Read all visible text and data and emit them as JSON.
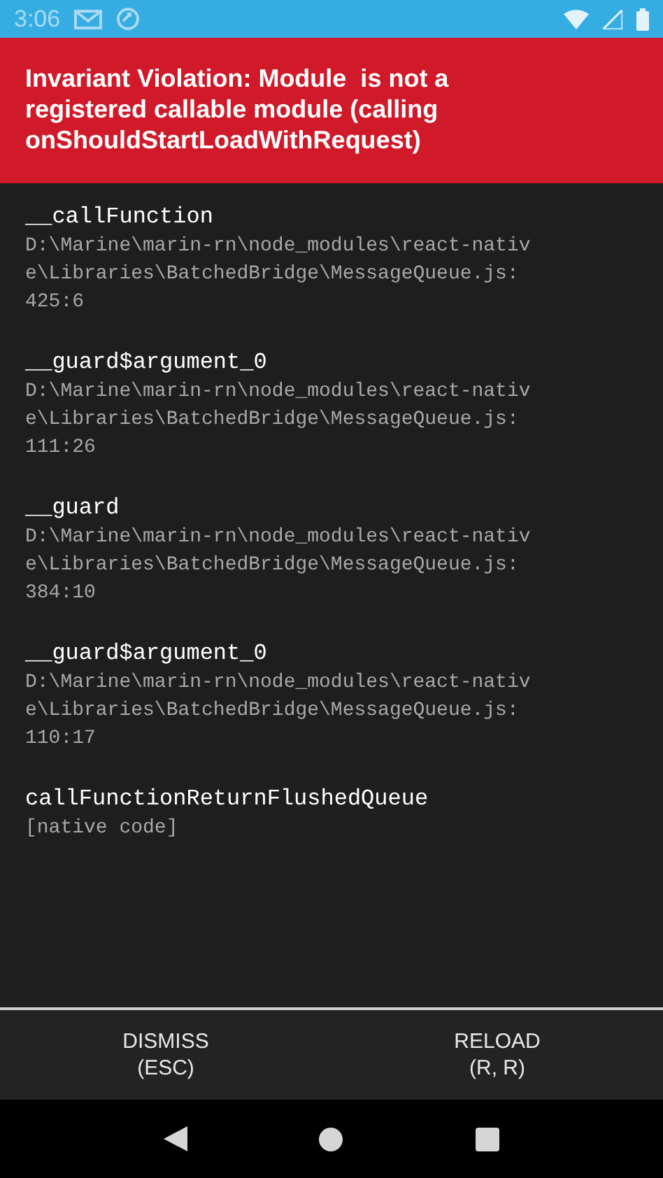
{
  "status_bar": {
    "time": "3:06"
  },
  "error": {
    "title": "Invariant Violation: Module  is not a registered callable module (calling onShouldStartLoadWithRequest)"
  },
  "stack": [
    {
      "method": "__callFunction",
      "file": "D:\\Marine\\marin-rn\\node_modules\\react-native\\Libraries\\BatchedBridge\\MessageQueue.js:",
      "position": "425:6"
    },
    {
      "method": "__guard$argument_0",
      "file": "D:\\Marine\\marin-rn\\node_modules\\react-native\\Libraries\\BatchedBridge\\MessageQueue.js:",
      "position": "111:26"
    },
    {
      "method": "__guard",
      "file": "D:\\Marine\\marin-rn\\node_modules\\react-native\\Libraries\\BatchedBridge\\MessageQueue.js:",
      "position": "384:10"
    },
    {
      "method": "__guard$argument_0",
      "file": "D:\\Marine\\marin-rn\\node_modules\\react-native\\Libraries\\BatchedBridge\\MessageQueue.js:",
      "position": "110:17"
    },
    {
      "method": "callFunctionReturnFlushedQueue",
      "file": "[native code]"
    }
  ],
  "buttons": [
    {
      "label": "DISMISS",
      "shortcut": "(ESC)"
    },
    {
      "label": "RELOAD",
      "shortcut": "(R, R)"
    }
  ]
}
